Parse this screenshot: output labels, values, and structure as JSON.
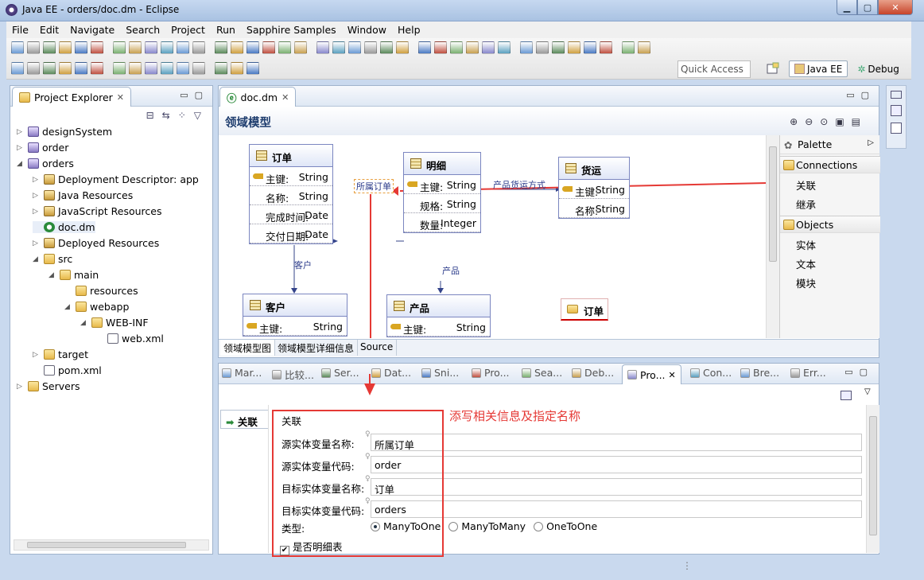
{
  "window": {
    "title": "Java EE - orders/doc.dm - Eclipse"
  },
  "menu": [
    "File",
    "Edit",
    "Navigate",
    "Search",
    "Project",
    "Run",
    "Sapphire Samples",
    "Window",
    "Help"
  ],
  "toolbar": {
    "quick_access": "Quick Access",
    "perspectives": [
      "Java EE",
      "Debug"
    ]
  },
  "explorer": {
    "title": "Project Explorer",
    "items": [
      {
        "label": "designSystem",
        "arrow": "▷",
        "icon": "project-icon"
      },
      {
        "label": "order",
        "arrow": "▷",
        "icon": "project-icon"
      },
      {
        "label": "orders",
        "arrow": "◢",
        "icon": "project-icon"
      },
      {
        "label": "Deployment Descriptor: app",
        "arrow": "▷",
        "icon": "descriptor-icon"
      },
      {
        "label": "Java Resources",
        "arrow": "▷",
        "icon": "java-resources-icon"
      },
      {
        "label": "JavaScript Resources",
        "arrow": "▷",
        "icon": "js-resources-icon"
      },
      {
        "label": "doc.dm",
        "arrow": "",
        "icon": "dm-file-icon"
      },
      {
        "label": "Deployed Resources",
        "arrow": "▷",
        "icon": "deployed-icon"
      },
      {
        "label": "src",
        "arrow": "◢",
        "icon": "folder-icon"
      },
      {
        "label": "main",
        "arrow": "◢",
        "icon": "folder-icon"
      },
      {
        "label": "resources",
        "arrow": "",
        "icon": "folder-icon"
      },
      {
        "label": "webapp",
        "arrow": "◢",
        "icon": "folder-icon"
      },
      {
        "label": "WEB-INF",
        "arrow": "◢",
        "icon": "folder-icon"
      },
      {
        "label": "web.xml",
        "arrow": "",
        "icon": "xml-file-icon"
      },
      {
        "label": "target",
        "arrow": "▷",
        "icon": "folder-icon"
      },
      {
        "label": "pom.xml",
        "arrow": "",
        "icon": "xml-file-icon"
      },
      {
        "label": "Servers",
        "arrow": "▷",
        "icon": "folder-icon"
      }
    ]
  },
  "editor": {
    "tab": "doc.dm",
    "header": "领域模型",
    "bottom_tabs": [
      "领域模型图",
      "领域模型详细信息",
      "Source"
    ],
    "entities": {
      "order": {
        "name": "订单",
        "rows": [
          {
            "key": true,
            "f": "主键:",
            "t": "String"
          },
          {
            "f": "名称:",
            "t": "String"
          },
          {
            "f": "完成时间:",
            "t": "Date"
          },
          {
            "f": "交付日期:",
            "t": "Date"
          }
        ]
      },
      "detail": {
        "name": "明细",
        "rows": [
          {
            "key": true,
            "f": "主键:",
            "t": "String"
          },
          {
            "f": "规格:",
            "t": "String"
          },
          {
            "f": "数量:",
            "t": "Integer"
          }
        ]
      },
      "shipping": {
        "name": "货运",
        "rows": [
          {
            "key": true,
            "f": "主键:",
            "t": "String"
          },
          {
            "f": "名称:",
            "t": "String"
          }
        ]
      },
      "customer": {
        "name": "客户",
        "rows": [
          {
            "key": true,
            "f": "主键:",
            "t": "String"
          }
        ]
      },
      "product": {
        "name": "产品",
        "rows": [
          {
            "key": true,
            "f": "主键:",
            "t": "String"
          }
        ]
      }
    },
    "links": {
      "belong_order": "所属订单",
      "customer": "客户",
      "product": "产品",
      "ship_mode": "产品货运方式"
    },
    "module_box": "订单"
  },
  "palette": {
    "title": "Palette",
    "connections": {
      "label": "Connections",
      "items": [
        "关联",
        "继承"
      ]
    },
    "objects": {
      "label": "Objects",
      "items": [
        "实体",
        "文本",
        "模块"
      ]
    }
  },
  "views": {
    "tabs": [
      "Mar...",
      "比较...",
      "Ser...",
      "Dat...",
      "Sni...",
      "Pro...",
      "Sea...",
      "Deb...",
      "Pro...",
      "Con...",
      "Bre...",
      "Err..."
    ],
    "active_index": 8
  },
  "properties": {
    "side_tab": "关联",
    "section_title": "关联",
    "fields": [
      {
        "label": "源实体变量名称:",
        "value": "所属订单"
      },
      {
        "label": "源实体变量代码:",
        "value": "order"
      },
      {
        "label": "目标实体变量名称:",
        "value": "订单"
      },
      {
        "label": "目标实体变量代码:",
        "value": "orders"
      }
    ],
    "type_label": "类型:",
    "type_options": [
      "ManyToOne",
      "ManyToMany",
      "OneToOne"
    ],
    "type_selected": "ManyToOne",
    "detail_label": "是否明细表",
    "detail_checked": true,
    "annotation": "添写相关信息及指定名称"
  },
  "colors": {
    "annotation": "#e53935",
    "accent": "#3b4f8f"
  }
}
